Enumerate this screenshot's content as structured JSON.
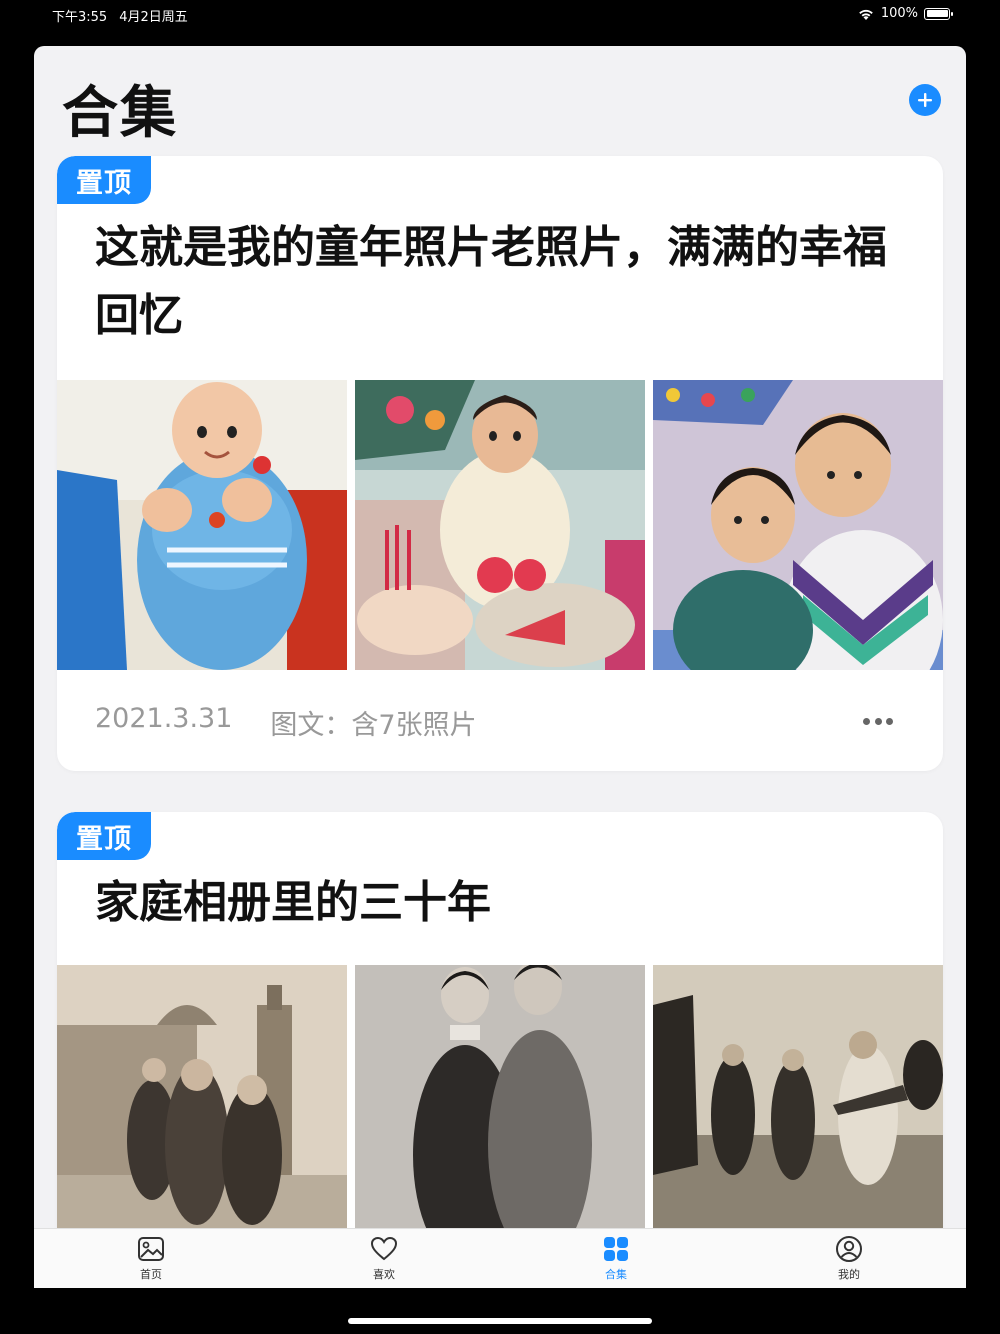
{
  "status_bar": {
    "time": "下午3:55",
    "date": "4月2日周五",
    "battery": "100%"
  },
  "header": {
    "title": "合集",
    "add_icon": "plus-icon",
    "accent_color": "#1a8cff"
  },
  "collections": [
    {
      "badge": "置顶",
      "title": "这就是我的童年照片老照片，满满的幸福回忆",
      "date": "2021.3.31",
      "info": "图文：含7张照片",
      "photos": [
        "baby-in-blue-outfit-photo",
        "toddler-with-birthday-cake-photo",
        "two-boys-hugging-photo"
      ]
    },
    {
      "badge": "置顶",
      "title": "家庭相册里的三十年",
      "photos": [
        "family-in-front-of-building-photo",
        "couple-portrait-photo",
        "men-on-sports-field-photo"
      ]
    }
  ],
  "tab_bar": {
    "tabs": [
      {
        "label": "首页",
        "icon": "photo-icon",
        "active": false
      },
      {
        "label": "喜欢",
        "icon": "heart-icon",
        "active": false
      },
      {
        "label": "合集",
        "icon": "grid-icon",
        "active": true
      },
      {
        "label": "我的",
        "icon": "person-icon",
        "active": false
      }
    ]
  }
}
